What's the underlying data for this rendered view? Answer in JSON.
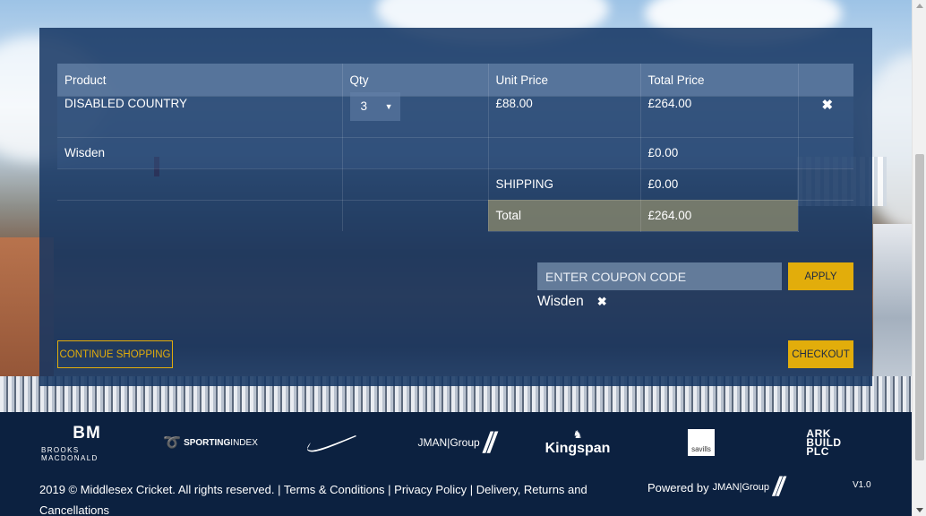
{
  "cart": {
    "headers": [
      "Product",
      "Qty",
      "Unit Price",
      "Total Price",
      ""
    ],
    "items": [
      {
        "product": "DISABLED COUNTRY",
        "qty": "3",
        "unit_price": "£88.00",
        "total_price": "£264.00"
      }
    ],
    "discount_row": {
      "product": "Wisden",
      "total_price": "£0.00"
    },
    "shipping": {
      "label": "SHIPPING",
      "value": "£0.00"
    },
    "total": {
      "label": "Total",
      "value": "£264.00"
    }
  },
  "coupon": {
    "placeholder": "ENTER COUPON CODE",
    "apply_label": "APPLY",
    "applied_code": "Wisden"
  },
  "actions": {
    "continue_label": "CONTINUE SHOPPING",
    "checkout_label": "CHECKOUT"
  },
  "sponsors": {
    "brooks_macdonald": {
      "mark": "BM",
      "name": "BROOKS MACDONALD"
    },
    "sporting_index": {
      "bold": "SPORTING",
      "light": "INDEX"
    },
    "nike": {
      "icon": "nike-swoosh-icon"
    },
    "jman": {
      "name": "JMAN|Group"
    },
    "kingspan": {
      "name": "Kingspan"
    },
    "savills": {
      "name": "savills"
    },
    "ark": {
      "line1": "ARK",
      "line2": "BUILD",
      "line3": "PLC"
    }
  },
  "footer": {
    "copyright": "2019 © Middlesex Cricket. All rights reserved. | ",
    "terms": "Terms & Conditions",
    "sep1": " | ",
    "privacy": "Privacy Policy",
    "sep2": " | ",
    "delivery": "Delivery, Returns and Cancellations",
    "powered_by": "Powered by",
    "powered_brand": "JMAN|Group",
    "version": "V1.0"
  },
  "colors": {
    "accent": "#e2ad0b",
    "panel": "#14345e",
    "footer": "#0c2140"
  }
}
